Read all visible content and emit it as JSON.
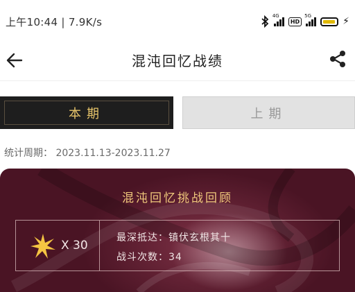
{
  "status_bar": {
    "time": "上午10:44",
    "network_speed": "7.9K/s",
    "signal_tag_1": "4G",
    "signal_tag_2": "5G",
    "hd_label": "HD",
    "battery_color": "#e0b800"
  },
  "header": {
    "title": "混沌回忆战绩",
    "back_icon": "arrow-left-icon",
    "share_icon": "share-icon"
  },
  "tabs": {
    "current": "本期",
    "previous": "上期",
    "active": "current"
  },
  "stats_period": {
    "label": "统计周期：",
    "range": "2023.11.13-2023.11.27"
  },
  "review": {
    "title": "混沌回忆挑战回顾",
    "star_count": "X 30",
    "deepest_label": "最深抵达：",
    "deepest_value": "镇伏玄根其十",
    "battles_label": "战斗次数：",
    "battles_value": "34"
  },
  "colors": {
    "tab_active_bg": "#1e1e1e",
    "tab_active_text": "#e7c46a",
    "tab_inactive_bg": "#e2e2e2",
    "card_title": "#f0c97c",
    "card_bg": "#4a1424",
    "star": "#f5c542"
  }
}
